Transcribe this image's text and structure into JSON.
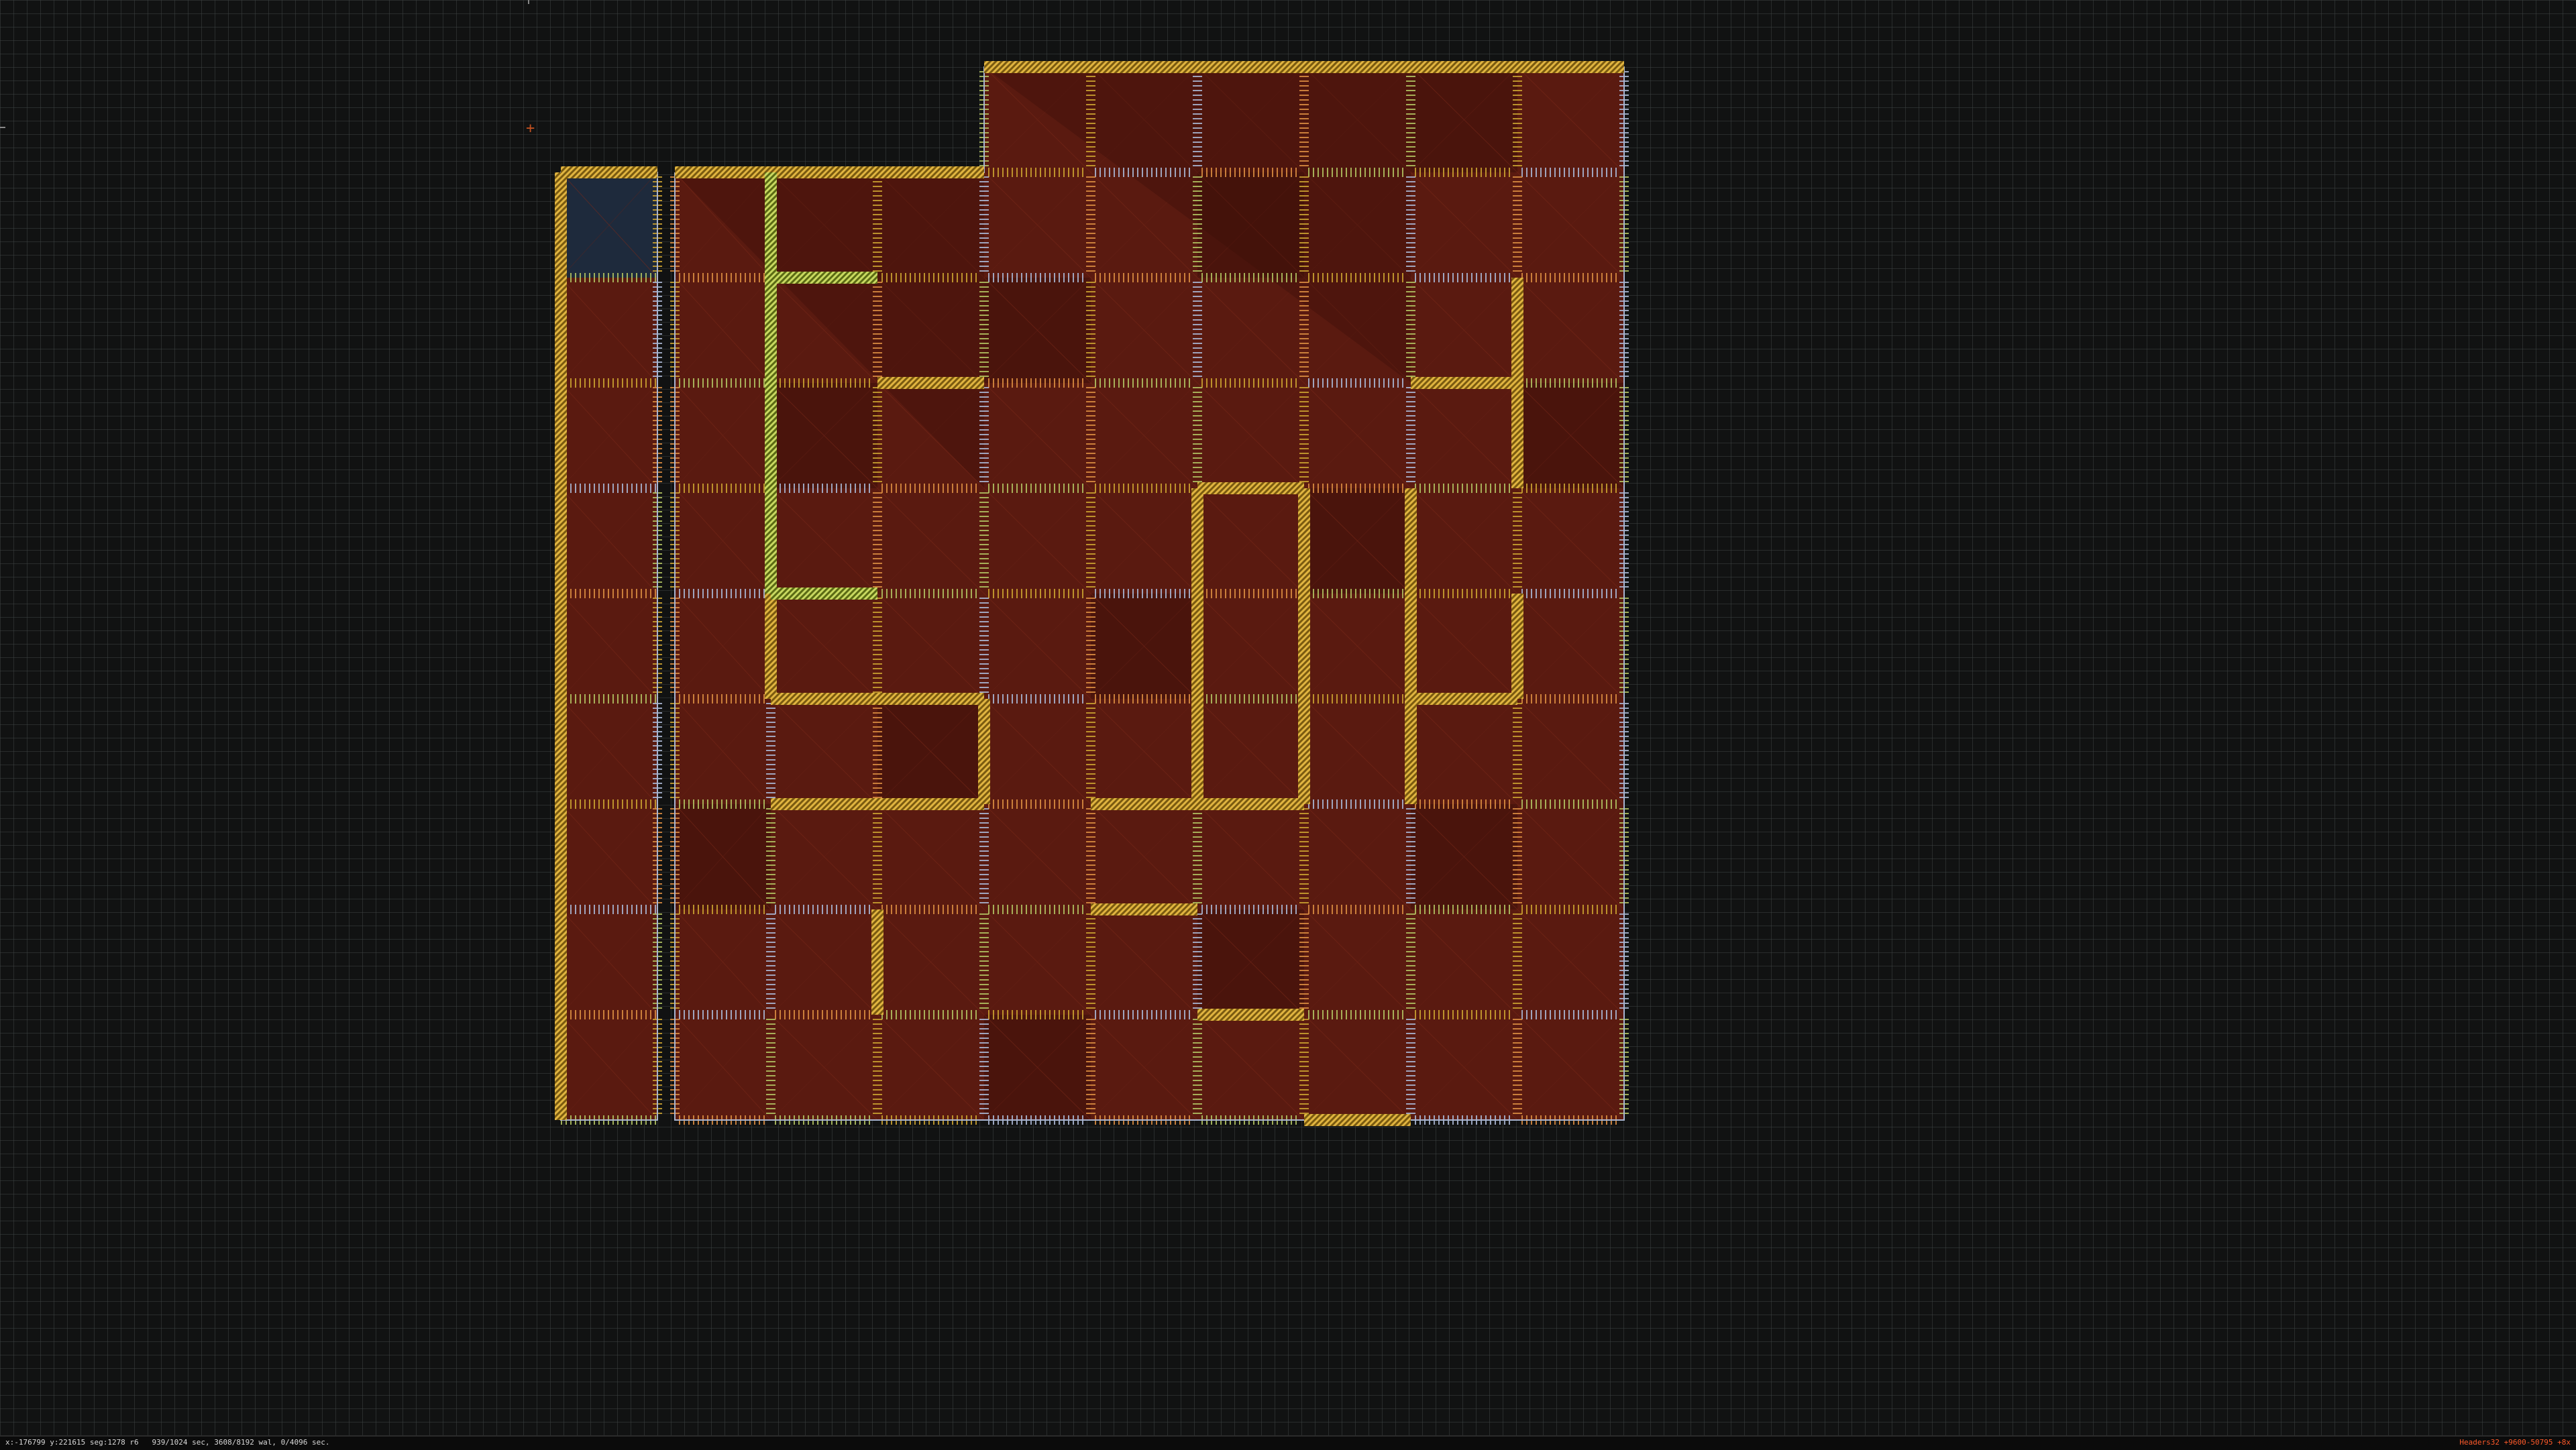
{
  "editor": {
    "status_left": "x:-176799 y:221615 seg:1278 r6   939/1024 sec, 3608/8192 wal, 0/4096 sec.",
    "status_right": "Headers32 +9600-50795 +8x"
  },
  "map": {
    "grid": "on",
    "sector_color": "#5a1a10",
    "selected_sector_color": "#1e2a3c",
    "wall_colors": [
      "#c8a030",
      "#a8b4d0",
      "#d88a40",
      "#b0c060"
    ],
    "thick_wall_color": "#b89030",
    "origin_marker_color": "#c05020"
  }
}
